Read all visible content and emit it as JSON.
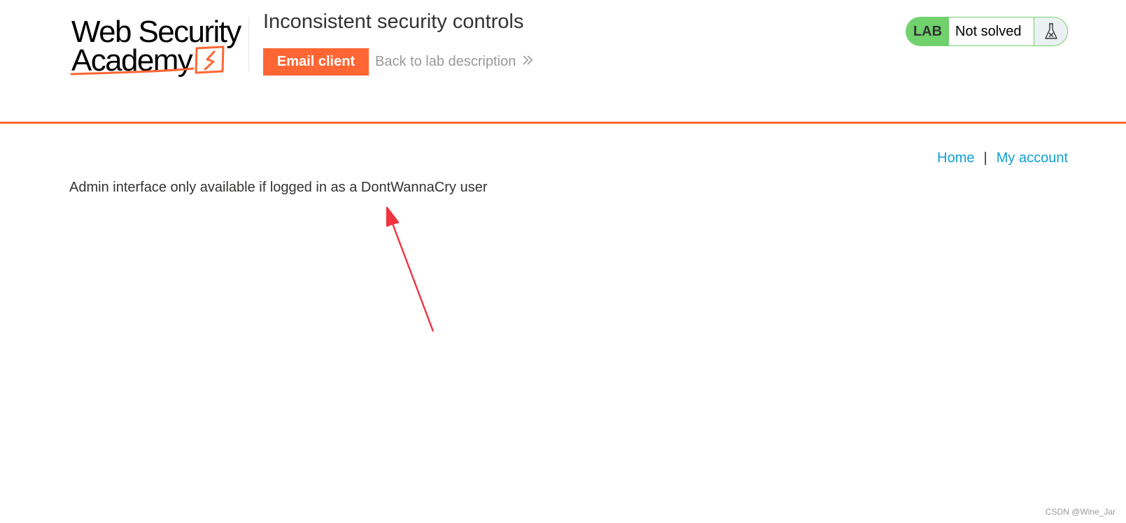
{
  "logo": {
    "line1": "Web Security",
    "line2": "Academy",
    "icon": "lightning-bolt-icon"
  },
  "header": {
    "lab_title": "Inconsistent security controls",
    "email_client_label": "Email client",
    "back_link_label": "Back to lab description",
    "back_link_icon": "double-chevron-right-icon"
  },
  "lab_status": {
    "badge": "LAB",
    "state": "Not solved",
    "icon": "flask-icon",
    "badge_color": "#70d16d"
  },
  "nav": {
    "home_label": "Home",
    "separator": "|",
    "my_account_label": "My account"
  },
  "main": {
    "message": "Admin interface only available if logged in as a DontWannaCry user"
  },
  "annotation": {
    "arrow_color": "#f0333f"
  },
  "watermark": "CSDN @Wine_Jar",
  "colors": {
    "accent": "#ff6633",
    "link": "#0f9fd6",
    "text": "#333332",
    "muted": "#999999"
  }
}
